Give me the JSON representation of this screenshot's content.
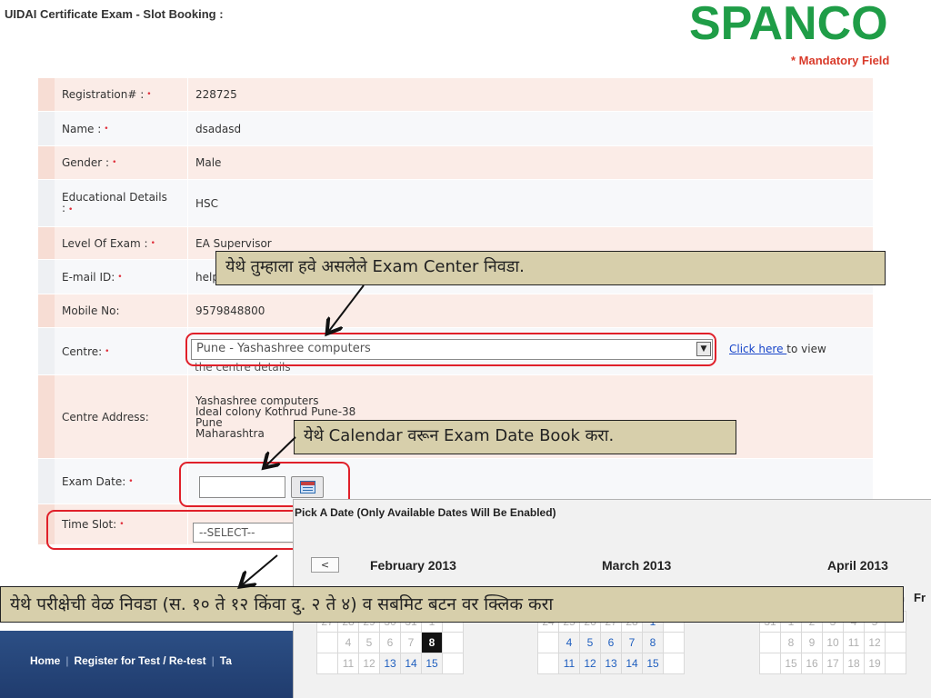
{
  "header": {
    "title": "UIDAI Certificate Exam - Slot Booking :",
    "logo_text": "SPANCO",
    "mandatory_note": "* Mandatory Field"
  },
  "form": {
    "registration": {
      "label": "Registration# :",
      "value": "228725"
    },
    "name": {
      "label": "Name :",
      "value": "dsadasd"
    },
    "gender": {
      "label": "Gender :",
      "value": "Male"
    },
    "education": {
      "label_line1": "Educational Details",
      "label_line2": ":",
      "value": "HSC"
    },
    "level": {
      "label": "Level Of Exam :",
      "value": "EA Supervisor"
    },
    "email": {
      "label": "E-mail ID:",
      "value": "help@..."
    },
    "mobile": {
      "label": "Mobile No:",
      "value": "9579848800"
    },
    "centre": {
      "label": "Centre:",
      "selected": "Pune - Yashashree computers",
      "link_text": "Click here ",
      "link_suffix": "to view",
      "details_text": "the centre details"
    },
    "centre_address": {
      "label": "Centre Address:",
      "line1": "Yashashree computers",
      "line2": "Ideal colony Kothrud Pune-38",
      "line3": "Pune",
      "line4": "Maharashtra"
    },
    "exam_date": {
      "label": "Exam Date:",
      "value": ""
    },
    "time_slot": {
      "label": "Time Slot:",
      "selected": "--SELECT--"
    },
    "required_marker": "•"
  },
  "callouts": {
    "centre": "येथे तुम्हाला हवे असलेले Exam Center निवडा.",
    "date": "येथे Calendar वरून Exam Date Book करा.",
    "time": "येथे परीक्षेची वेळ निवडा (स. १० ते १२ किंवा दु. २ ते ४) व सबमिट बटन वर क्लिक करा"
  },
  "footer": {
    "links": [
      "Home",
      "Register for Test / Re-test",
      "Ta"
    ]
  },
  "calendar": {
    "title": "Pick A Date (Only Available Dates Will Be Enabled)",
    "prev_label": "<",
    "months": [
      {
        "name": "February 2013",
        "rows": [
          [
            "27",
            "28",
            "29",
            "30",
            "31",
            "1",
            ""
          ],
          [
            "",
            "4",
            "5",
            "6",
            "7",
            "8",
            ""
          ],
          [
            "",
            "11",
            "12",
            "13",
            "14",
            "15",
            ""
          ]
        ]
      },
      {
        "name": "March 2013",
        "rows": [
          [
            "24",
            "25",
            "26",
            "27",
            "28",
            "1",
            ""
          ],
          [
            "",
            "4",
            "5",
            "6",
            "7",
            "8",
            ""
          ],
          [
            "",
            "11",
            "12",
            "13",
            "14",
            "15",
            ""
          ]
        ]
      },
      {
        "name": "April 2013",
        "rows": [
          [
            "31",
            "1",
            "2",
            "3",
            "4",
            "5",
            ""
          ],
          [
            "",
            "8",
            "9",
            "10",
            "11",
            "12",
            ""
          ],
          [
            "",
            "15",
            "16",
            "17",
            "18",
            "19",
            ""
          ]
        ]
      }
    ],
    "dow_partial": [
      "h",
      "Fr"
    ],
    "selected_day": "8"
  }
}
